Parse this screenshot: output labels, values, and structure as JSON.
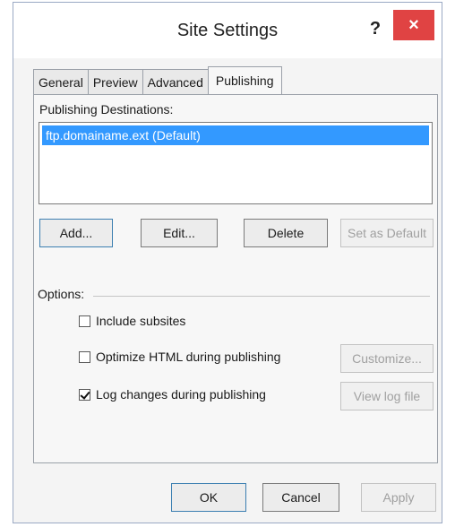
{
  "dialog": {
    "title": "Site Settings",
    "help_label": "?",
    "close_label": "×"
  },
  "tabs": [
    {
      "label": "General"
    },
    {
      "label": "Preview"
    },
    {
      "label": "Advanced"
    },
    {
      "label": "Publishing",
      "active": true
    }
  ],
  "publishing": {
    "destinations_label": "Publishing Destinations:",
    "destinations": [
      "ftp.domainame.ext (Default)"
    ],
    "buttons": {
      "add": "Add...",
      "edit": "Edit...",
      "delete": "Delete",
      "set_default": "Set as Default"
    },
    "options_label": "Options:",
    "options": {
      "include_subsites": {
        "label": "Include subsites",
        "checked": false
      },
      "optimize_html": {
        "label": "Optimize HTML during publishing",
        "checked": false
      },
      "log_changes": {
        "label": "Log changes during publishing",
        "checked": true
      }
    },
    "customize_label": "Customize...",
    "view_log_label": "View log file"
  },
  "footer": {
    "ok": "OK",
    "cancel": "Cancel",
    "apply": "Apply"
  },
  "colors": {
    "selection": "#3399ff",
    "close_button": "#e04343"
  }
}
